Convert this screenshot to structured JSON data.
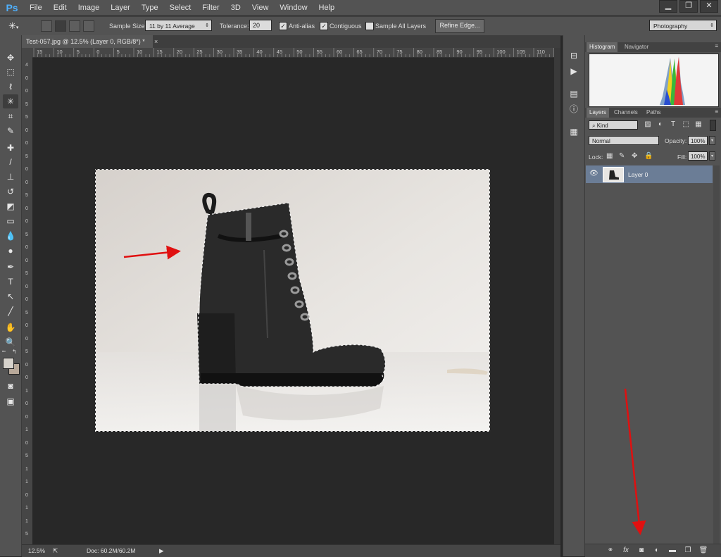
{
  "app": {
    "logo": "Ps",
    "brand_color": "#4fb1ff"
  },
  "menu": [
    "File",
    "Edit",
    "Image",
    "Layer",
    "Type",
    "Select",
    "Filter",
    "3D",
    "View",
    "Window",
    "Help"
  ],
  "window_controls": {
    "minimize": "▁",
    "restore": "❐",
    "close": "✕"
  },
  "options": {
    "tool_icon": "magic-wand-icon",
    "sample_size_label": "Sample Size:",
    "sample_size_value": "11 by 11 Average",
    "tolerance_label": "Tolerance:",
    "tolerance_value": "20",
    "anti_alias_label": "Anti-alias",
    "anti_alias_checked": true,
    "contiguous_label": "Contiguous",
    "contiguous_checked": true,
    "sample_all_label": "Sample All Layers",
    "sample_all_checked": false,
    "refine_edge_label": "Refine Edge...",
    "workspace_value": "Photography"
  },
  "document": {
    "tab_title": "Test-057.jpg @ 12.5% (Layer 0, RGB/8*) *",
    "close_glyph": "×",
    "zoom": "12.5%",
    "doc_size": "Doc: 60.2M/60.2M",
    "ruler_top": [
      "15",
      "10",
      "5",
      "0",
      "5",
      "10",
      "15",
      "20",
      "25",
      "30",
      "35",
      "40",
      "45",
      "50",
      "55",
      "60",
      "65",
      "70",
      "75",
      "80",
      "85",
      "90",
      "95",
      "100",
      "105",
      "110"
    ],
    "ruler_left": [
      "4",
      "0",
      "0",
      "5",
      "5",
      "0",
      "0",
      "5",
      "0",
      "0",
      "5",
      "0",
      "0",
      "5",
      "0",
      "0",
      "5",
      "0",
      "0",
      "5",
      "0",
      "0",
      "5",
      "0",
      "0",
      "1",
      "0",
      "0",
      "1",
      "0",
      "5",
      "1",
      "1",
      "0",
      "1",
      "1",
      "5"
    ]
  },
  "panels": {
    "histogram_tab": "Histogram",
    "navigator_tab": "Navigator",
    "layers_tab": "Layers",
    "channels_tab": "Channels",
    "paths_tab": "Paths",
    "kind_label": "Kind",
    "blend_mode": "Normal",
    "opacity_label": "Opacity:",
    "opacity_value": "100%",
    "lock_label": "Lock:",
    "fill_label": "Fill:",
    "fill_value": "100%",
    "layer_name": "Layer 0",
    "eye_icon": "eye-icon"
  },
  "colors": {
    "selected_layer": "#6b7d96",
    "annotation_arrow": "#e01010"
  }
}
